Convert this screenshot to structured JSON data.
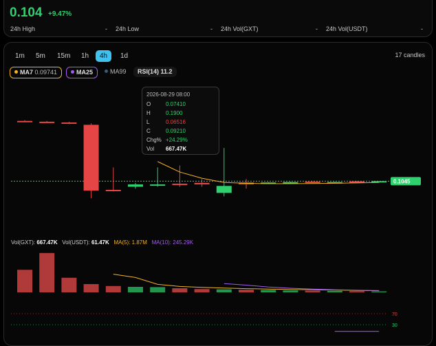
{
  "header": {
    "price": "0.104",
    "change": "+9.47%",
    "stats": [
      {
        "label": "24h High",
        "value": "-"
      },
      {
        "label": "24h Low",
        "value": "-"
      },
      {
        "label": "24h Vol(GXT)",
        "value": "-"
      },
      {
        "label": "24h Vol(USDT)",
        "value": "-"
      }
    ]
  },
  "timeframes": [
    "1m",
    "5m",
    "15m",
    "1h",
    "4h",
    "1d"
  ],
  "active_timeframe": "4h",
  "candle_count_label": "17 candles",
  "indicators": {
    "ma7": {
      "label": "MA7",
      "value": "0.09741",
      "color": "#f5b41e"
    },
    "ma25": {
      "label": "MA25",
      "color": "#a45cf0"
    },
    "ma99": {
      "label": "MA99",
      "color": "#3a5a78"
    },
    "rsi": {
      "label": "RSI(14)",
      "value": "11.2"
    }
  },
  "tooltip": {
    "time": "2026-08-29 08:00",
    "o_label": "O",
    "o": "0.07410",
    "h_label": "H",
    "h": "0.1900",
    "l_label": "L",
    "l": "0.06516",
    "c_label": "C",
    "c": "0.09210",
    "chg_label": "Chg%",
    "chg": "+24.29%",
    "vol_label": "Vol",
    "vol": "667.47K"
  },
  "price_tag": "0.1045",
  "volume_legend": {
    "vol_base_label": "Vol(GXT):",
    "vol_base": "667.47K",
    "vol_quote_label": "Vol(USDT):",
    "vol_quote": "61.47K",
    "ma5_label": "MA(5):",
    "ma5": "1.87M",
    "ma10_label": "MA(10):",
    "ma10": "245.29K"
  },
  "rsi_levels": {
    "upper": "70",
    "lower": "30"
  },
  "colors": {
    "up": "#2fd16e",
    "down": "#e54545",
    "accent": "#3fc3ee"
  },
  "chart_data": {
    "type": "candlestick",
    "price_marker": 0.1045,
    "candles": [
      {
        "o": 0.26,
        "h": 0.262,
        "l": 0.258,
        "c": 0.259
      },
      {
        "o": 0.258,
        "h": 0.26,
        "l": 0.255,
        "c": 0.256
      },
      {
        "o": 0.256,
        "h": 0.258,
        "l": 0.252,
        "c": 0.254
      },
      {
        "o": 0.25,
        "h": 0.254,
        "l": 0.06,
        "c": 0.08
      },
      {
        "o": 0.082,
        "h": 0.14,
        "l": 0.078,
        "c": 0.08
      },
      {
        "o": 0.09,
        "h": 0.1,
        "l": 0.085,
        "c": 0.096
      },
      {
        "o": 0.094,
        "h": 0.14,
        "l": 0.09,
        "c": 0.096
      },
      {
        "o": 0.098,
        "h": 0.145,
        "l": 0.09,
        "c": 0.095
      },
      {
        "o": 0.1,
        "h": 0.11,
        "l": 0.09,
        "c": 0.096
      },
      {
        "o": 0.0741,
        "h": 0.19,
        "l": 0.06516,
        "c": 0.0921
      },
      {
        "o": 0.101,
        "h": 0.11,
        "l": 0.085,
        "c": 0.096
      },
      {
        "o": 0.1,
        "h": 0.102,
        "l": 0.099,
        "c": 0.101
      },
      {
        "o": 0.101,
        "h": 0.103,
        "l": 0.099,
        "c": 0.102
      },
      {
        "o": 0.103,
        "h": 0.104,
        "l": 0.102,
        "c": 0.102
      },
      {
        "o": 0.102,
        "h": 0.103,
        "l": 0.101,
        "c": 0.102
      },
      {
        "o": 0.104,
        "h": 0.105,
        "l": 0.102,
        "c": 0.103
      },
      {
        "o": 0.102,
        "h": 0.104,
        "l": 0.101,
        "c": 0.1045
      }
    ],
    "volumes": [
      820,
      1430,
      530,
      300,
      230,
      200,
      190,
      150,
      120,
      110,
      95,
      85,
      70,
      60,
      55,
      45,
      35
    ],
    "volume_max": 1500,
    "ma7": [
      null,
      null,
      null,
      null,
      null,
      null,
      0.155,
      0.128,
      0.112,
      0.101,
      0.099,
      0.098,
      0.098,
      0.0985,
      0.099,
      0.1,
      0.101
    ],
    "vol_ma5": [
      null,
      null,
      null,
      null,
      660,
      540,
      290,
      215,
      180,
      155,
      135,
      120,
      105,
      95,
      85,
      70,
      60
    ],
    "vol_ma10": [
      null,
      null,
      null,
      null,
      null,
      null,
      null,
      null,
      null,
      320,
      262,
      195,
      150,
      120,
      95,
      78,
      65
    ],
    "rsi_values": [
      null,
      null,
      null,
      null,
      null,
      null,
      null,
      null,
      null,
      null,
      null,
      null,
      null,
      null,
      11.5,
      11.2,
      11.2
    ],
    "price_min": 0.05,
    "price_max": 0.32
  }
}
